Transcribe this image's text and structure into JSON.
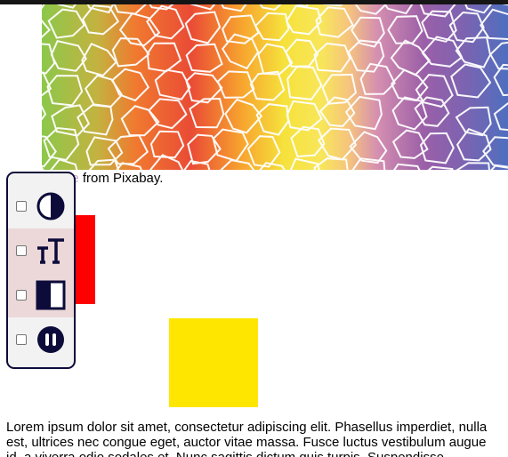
{
  "caption": {
    "part1": "Image",
    "part2": " from Pixabay."
  },
  "toolbar": {
    "options": [
      {
        "icon": "contrast-icon",
        "checked": false
      },
      {
        "icon": "text-size-icon",
        "checked": false
      },
      {
        "icon": "invert-colors-icon",
        "checked": false
      },
      {
        "icon": "pause-animation-icon",
        "checked": false
      }
    ]
  },
  "colors": {
    "red_block": "#ff0000",
    "yellow_block": "#ffe600",
    "panel_border": "#0d0b3a"
  },
  "body_text": {
    "line1": "Lorem ipsum dolor sit amet, consectetur adipiscing elit. Phasellus imperdiet, nulla",
    "line2": "est, ultrices nec congue eget, auctor vitae massa. Fusce luctus vestibulum augue",
    "line3": "id, a viverra odio sodales et. Nunc sagittis dictum quis turpis. Suspendisse"
  }
}
